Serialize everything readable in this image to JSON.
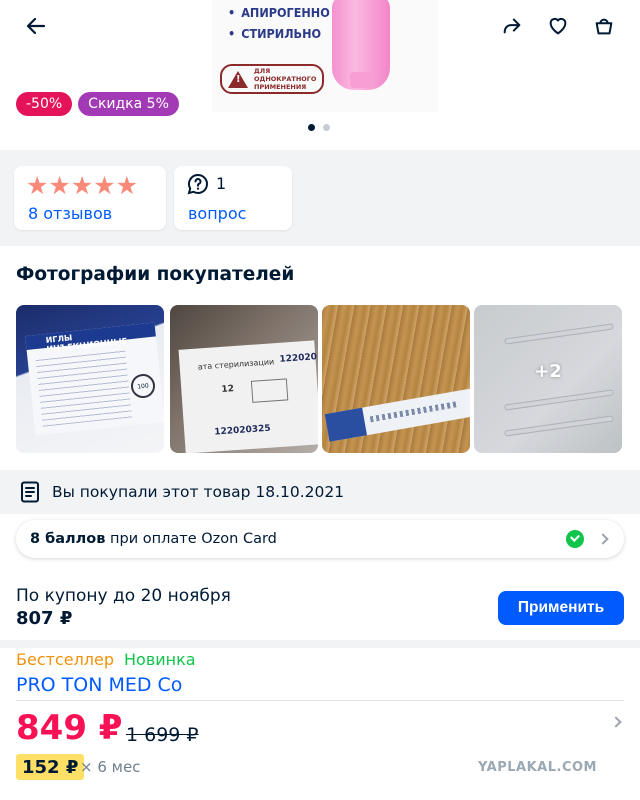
{
  "product_image": {
    "bullets": [
      "АПИРОГЕННО",
      "СТИРИЛЬНО"
    ],
    "single_use_text": "ДЛЯ ОДНОКРАТНОГО ПРИМЕНЕНИЯ"
  },
  "badges": {
    "discount": "-50%",
    "promo": "Скидка 5%"
  },
  "reviews": {
    "stars": "★★★★★",
    "reviews_link": "8 отзывов",
    "questions_count": "1",
    "questions_link": "вопрос"
  },
  "customer_photos": {
    "title": "Фотографии покупателей",
    "photo1": {
      "brand": "ИГЛЫ ИНЪЕКЦИОННЫЕ",
      "count": "100"
    },
    "photo2": {
      "sterilization": "ата стерилизации",
      "code_top": "122020",
      "lot": "12",
      "code_bottom": "122020325"
    },
    "more_label": "+2"
  },
  "purchase_note": "Вы покупали этот товар 18.10.2021",
  "ozon_card": {
    "points": "8 баллов",
    "text": " при оплате Ozon Card"
  },
  "coupon": {
    "text": "По купону до 20 ноября",
    "price": "807 ₽",
    "apply_button": "Применить"
  },
  "tags": {
    "bestseller": "Бестселлер",
    "new": "Новинка"
  },
  "brand": "PRO TON MED Co",
  "price": {
    "current": "849 ₽",
    "old": "1 699 ₽"
  },
  "installment": {
    "amount": "152 ₽",
    "term": "× 6 мес"
  },
  "watermark": "YAPLAKAL.COM"
}
